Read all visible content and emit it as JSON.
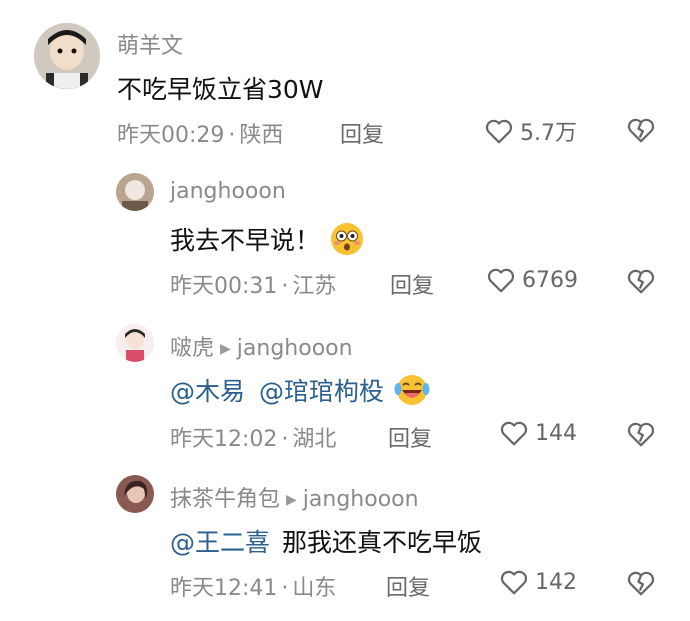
{
  "comments": [
    {
      "author": "萌羊文",
      "text": "不吃早饭立省30W",
      "time": "昨天00:29",
      "location": "陕西",
      "reply_label": "回复",
      "likes": "5.7万"
    },
    {
      "author": "janghooon",
      "text": "我去不早说！",
      "time": "昨天00:31",
      "location": "江苏",
      "reply_label": "回复",
      "likes": "6769"
    },
    {
      "author": "啵虎",
      "reply_to": "janghooon",
      "mention1": "@木易",
      "mention2": "@琯琯枸杸",
      "time": "昨天12:02",
      "location": "湖北",
      "reply_label": "回复",
      "likes": "144"
    },
    {
      "author": "抹茶牛角包",
      "reply_to": "janghooon",
      "mention1": "@王二喜",
      "text": "那我还真不吃早饭",
      "time": "昨天12:41",
      "location": "山东",
      "reply_label": "回复",
      "likes": "142"
    }
  ],
  "separator": "·",
  "icons": {
    "like": "heart-outline-icon",
    "dislike": "broken-heart-icon",
    "reply_arrow": "triangle-right-icon"
  },
  "colors": {
    "mention": "#2a5f8f",
    "meta": "#8a8a8a"
  }
}
